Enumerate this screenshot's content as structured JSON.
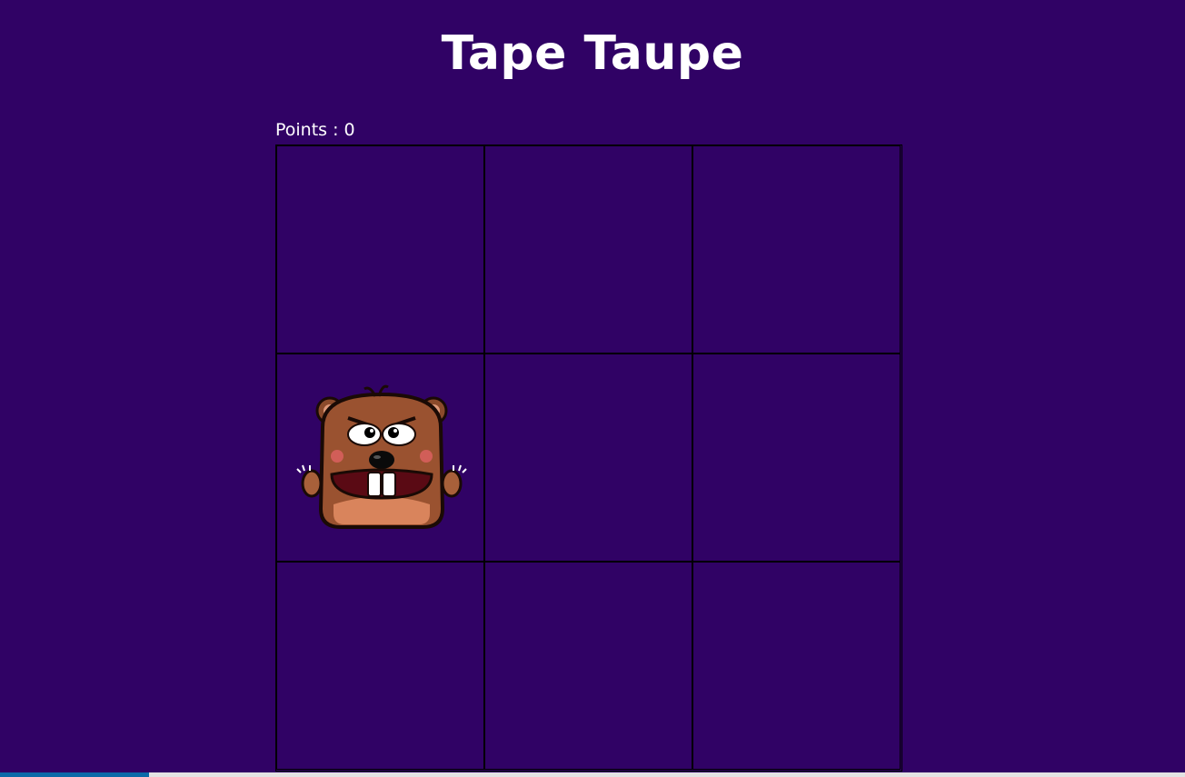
{
  "game": {
    "title": "Tape Taupe",
    "score_label": "Points : 0",
    "grid": {
      "rows": 3,
      "cols": 3,
      "mole_cell": 3
    }
  },
  "colors": {
    "background": "#300265",
    "text": "#ffffff",
    "grid_line": "#000000",
    "progress_fill": "#0b6aa8",
    "progress_track": "#e3e3e3"
  },
  "icons": {
    "mole": "mole-icon"
  },
  "progress": {
    "fraction": 0.126
  }
}
